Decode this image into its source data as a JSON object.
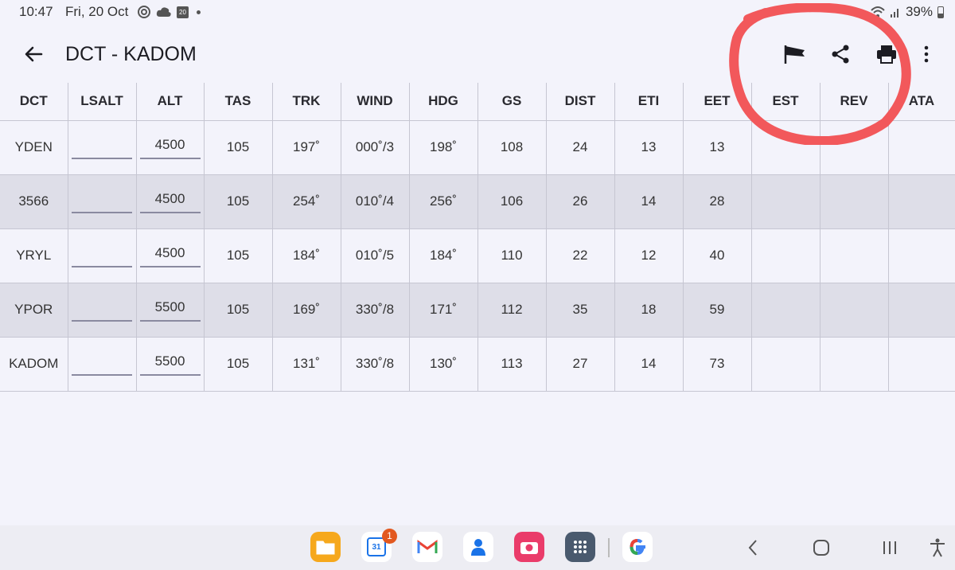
{
  "status_bar": {
    "time": "10:47",
    "date": "Fri, 20 Oct",
    "calendar_day": "20",
    "battery": "39%"
  },
  "app_bar": {
    "title": "DCT - KADOM",
    "icons": [
      "back-arrow-icon",
      "windsock-icon",
      "share-icon",
      "print-icon",
      "more-vert-icon"
    ]
  },
  "table": {
    "columns": [
      "DCT",
      "LSALT",
      "ALT",
      "TAS",
      "TRK",
      "WIND",
      "HDG",
      "GS",
      "DIST",
      "ETI",
      "EET",
      "EST",
      "REV",
      "ATA"
    ],
    "rows": [
      {
        "dct": "YDEN",
        "lsalt": "",
        "alt": "4500",
        "tas": "105",
        "trk": "197˚",
        "wind": "000˚/3",
        "hdg": "198˚",
        "gs": "108",
        "dist": "24",
        "eti": "13",
        "eet": "13",
        "est": "",
        "rev": "",
        "ata": ""
      },
      {
        "dct": "3566",
        "lsalt": "",
        "alt": "4500",
        "tas": "105",
        "trk": "254˚",
        "wind": "010˚/4",
        "hdg": "256˚",
        "gs": "106",
        "dist": "26",
        "eti": "14",
        "eet": "28",
        "est": "",
        "rev": "",
        "ata": ""
      },
      {
        "dct": "YRYL",
        "lsalt": "",
        "alt": "4500",
        "tas": "105",
        "trk": "184˚",
        "wind": "010˚/5",
        "hdg": "184˚",
        "gs": "110",
        "dist": "22",
        "eti": "12",
        "eet": "40",
        "est": "",
        "rev": "",
        "ata": ""
      },
      {
        "dct": "YPOR",
        "lsalt": "",
        "alt": "5500",
        "tas": "105",
        "trk": "169˚",
        "wind": "330˚/8",
        "hdg": "171˚",
        "gs": "112",
        "dist": "35",
        "eti": "18",
        "eet": "59",
        "est": "",
        "rev": "",
        "ata": ""
      },
      {
        "dct": "KADOM",
        "lsalt": "",
        "alt": "5500",
        "tas": "105",
        "trk": "131˚",
        "wind": "330˚/8",
        "hdg": "130˚",
        "gs": "113",
        "dist": "27",
        "eti": "14",
        "eet": "73",
        "est": "",
        "rev": "",
        "ata": ""
      }
    ]
  },
  "annotation": {
    "color": "#f2585b"
  },
  "dock": {
    "apps": [
      "my-files-icon",
      "calendar-icon",
      "gmail-icon",
      "contacts-icon",
      "camera-icon",
      "app-drawer-icon",
      "google-icon"
    ],
    "calendar_badge": "1",
    "calendar_day": "31"
  },
  "nav": {
    "icons": [
      "recents-back-icon",
      "home-icon",
      "recents-icon",
      "accessibility-icon"
    ]
  },
  "colors": {
    "background": "#f3f3fb",
    "alt_row": "#dedee8",
    "grid_line": "#c6c6d2"
  }
}
